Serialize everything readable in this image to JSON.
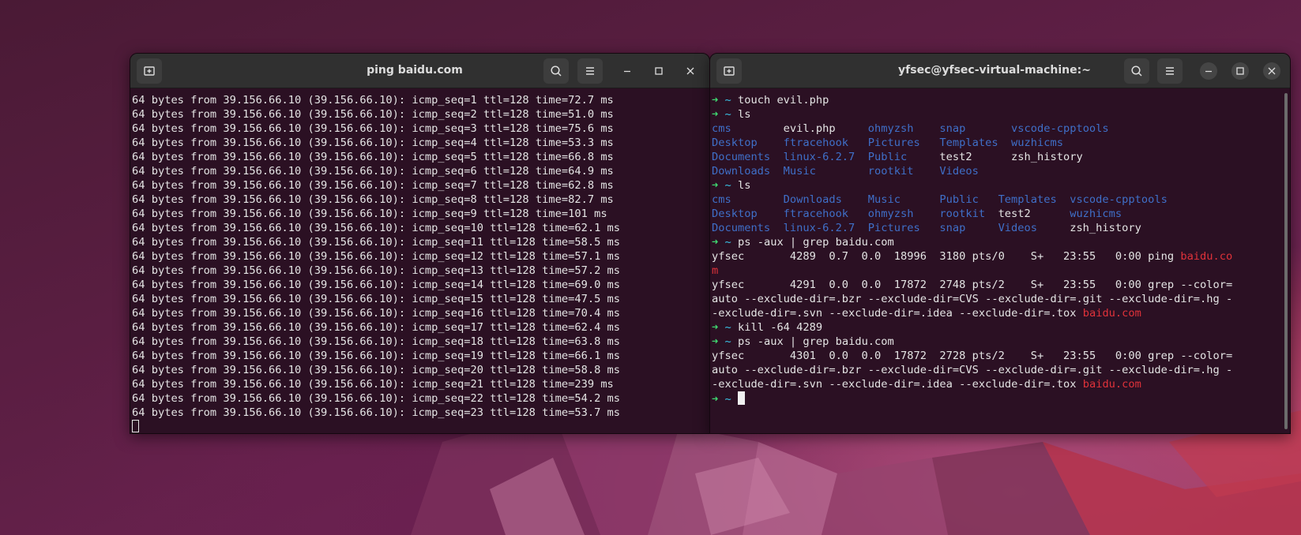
{
  "left_terminal": {
    "title": "ping baidu.com",
    "lines": [
      "64 bytes from 39.156.66.10 (39.156.66.10): icmp_seq=1 ttl=128 time=72.7 ms",
      "64 bytes from 39.156.66.10 (39.156.66.10): icmp_seq=2 ttl=128 time=51.0 ms",
      "64 bytes from 39.156.66.10 (39.156.66.10): icmp_seq=3 ttl=128 time=75.6 ms",
      "64 bytes from 39.156.66.10 (39.156.66.10): icmp_seq=4 ttl=128 time=53.3 ms",
      "64 bytes from 39.156.66.10 (39.156.66.10): icmp_seq=5 ttl=128 time=66.8 ms",
      "64 bytes from 39.156.66.10 (39.156.66.10): icmp_seq=6 ttl=128 time=64.9 ms",
      "64 bytes from 39.156.66.10 (39.156.66.10): icmp_seq=7 ttl=128 time=62.8 ms",
      "64 bytes from 39.156.66.10 (39.156.66.10): icmp_seq=8 ttl=128 time=82.7 ms",
      "64 bytes from 39.156.66.10 (39.156.66.10): icmp_seq=9 ttl=128 time=101 ms",
      "64 bytes from 39.156.66.10 (39.156.66.10): icmp_seq=10 ttl=128 time=62.1 ms",
      "64 bytes from 39.156.66.10 (39.156.66.10): icmp_seq=11 ttl=128 time=58.5 ms",
      "64 bytes from 39.156.66.10 (39.156.66.10): icmp_seq=12 ttl=128 time=57.1 ms",
      "64 bytes from 39.156.66.10 (39.156.66.10): icmp_seq=13 ttl=128 time=57.2 ms",
      "64 bytes from 39.156.66.10 (39.156.66.10): icmp_seq=14 ttl=128 time=69.0 ms",
      "64 bytes from 39.156.66.10 (39.156.66.10): icmp_seq=15 ttl=128 time=47.5 ms",
      "64 bytes from 39.156.66.10 (39.156.66.10): icmp_seq=16 ttl=128 time=70.4 ms",
      "64 bytes from 39.156.66.10 (39.156.66.10): icmp_seq=17 ttl=128 time=62.4 ms",
      "64 bytes from 39.156.66.10 (39.156.66.10): icmp_seq=18 ttl=128 time=63.8 ms",
      "64 bytes from 39.156.66.10 (39.156.66.10): icmp_seq=19 ttl=128 time=66.1 ms",
      "64 bytes from 39.156.66.10 (39.156.66.10): icmp_seq=20 ttl=128 time=58.8 ms",
      "64 bytes from 39.156.66.10 (39.156.66.10): icmp_seq=21 ttl=128 time=239 ms",
      "64 bytes from 39.156.66.10 (39.156.66.10): icmp_seq=22 ttl=128 time=54.2 ms",
      "64 bytes from 39.156.66.10 (39.156.66.10): icmp_seq=23 ttl=128 time=53.7 ms"
    ]
  },
  "right_terminal": {
    "title": "yfsec@yfsec-virtual-machine:~",
    "prompt_arrow": "➜",
    "prompt_dir": "~",
    "commands": {
      "touch": "touch evil.php",
      "ls": "ls",
      "ps_grep": "ps -aux | grep baidu.com",
      "kill": "kill -64 4289"
    },
    "ls1": [
      [
        "cms",
        "evil.php",
        "ohmyzsh",
        "snap",
        "vscode-cpptools"
      ],
      [
        "Desktop",
        "ftracehook",
        "Pictures",
        "Templates",
        "wuzhicms"
      ],
      [
        "Documents",
        "linux-6.2.7",
        "Public",
        "test2",
        "zsh_history"
      ],
      [
        "Downloads",
        "Music",
        "rootkit",
        "Videos",
        ""
      ]
    ],
    "ls1_colors": [
      [
        "blue",
        "plain",
        "blue",
        "blue",
        "blue"
      ],
      [
        "blue",
        "blue",
        "blue",
        "blue",
        "blue"
      ],
      [
        "blue",
        "blue",
        "blue",
        "plain",
        "plain"
      ],
      [
        "blue",
        "blue",
        "blue",
        "blue",
        "plain"
      ]
    ],
    "ls2": [
      [
        "cms",
        "Downloads",
        "Music",
        "Public",
        "Templates",
        "vscode-cpptools"
      ],
      [
        "Desktop",
        "ftracehook",
        "ohmyzsh",
        "rootkit",
        "test2",
        "wuzhicms"
      ],
      [
        "Documents",
        "linux-6.2.7",
        "Pictures",
        "snap",
        "Videos",
        "zsh_history"
      ]
    ],
    "ls2_colors": [
      [
        "blue",
        "blue",
        "blue",
        "blue",
        "blue",
        "blue"
      ],
      [
        "blue",
        "blue",
        "blue",
        "blue",
        "plain",
        "blue"
      ],
      [
        "blue",
        "blue",
        "blue",
        "blue",
        "blue",
        "plain"
      ]
    ],
    "ps1_row1_a": "yfsec       4289  0.7  0.0  18996  3180 pts/0    S+   23:55   0:00 ping ",
    "ps1_row1_hl": "baidu.co",
    "ps1_row1_wrap": "m",
    "ps1_row2_a": "yfsec       4291  0.0  0.0  17872  2748 pts/2    S+   23:55   0:00 grep --color=",
    "ps2_row_a": "yfsec       4301  0.0  0.0  17872  2728 pts/2    S+   23:55   0:00 grep --color=",
    "grep_cont1": "auto --exclude-dir=.bzr --exclude-dir=CVS --exclude-dir=.git --exclude-dir=.hg -",
    "grep_cont2": "-exclude-dir=.svn --exclude-dir=.idea --exclude-dir=.tox ",
    "grep_hl": "baidu.com"
  },
  "icons": {
    "new_tab": "new-tab-icon",
    "search": "search-icon",
    "menu": "hamburger-menu-icon",
    "minimize": "minimize-icon",
    "maximize": "maximize-icon",
    "close": "close-icon"
  }
}
